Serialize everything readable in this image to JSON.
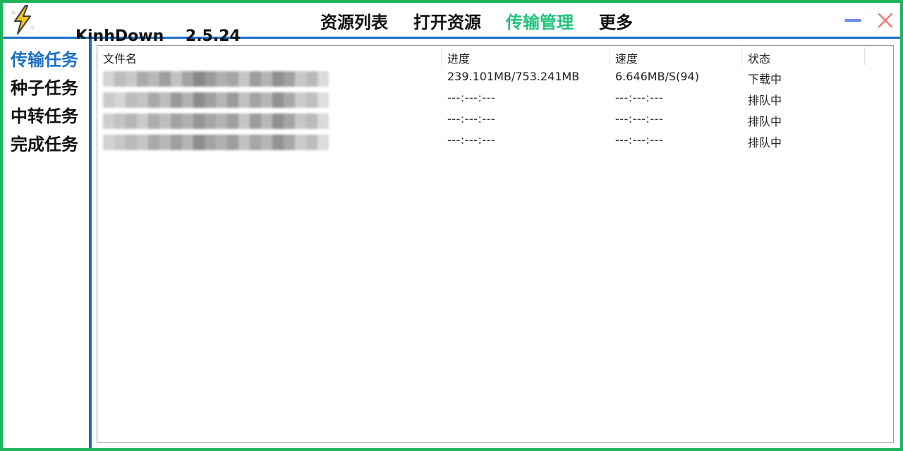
{
  "app": {
    "name": "KinhDown",
    "version": "2.5.24",
    "accent_active_nav": "#22c47a",
    "accent_blue": "#1a6fc4",
    "frame_green": "#1fb35c"
  },
  "nav": [
    {
      "label": "资源列表",
      "active": false
    },
    {
      "label": "打开资源",
      "active": false
    },
    {
      "label": "传输管理",
      "active": true
    },
    {
      "label": "更多",
      "active": false
    }
  ],
  "window_controls": {
    "minimize_icon": "minimize-icon",
    "close_icon": "close-icon"
  },
  "sidebar": [
    {
      "label": "传输任务",
      "active": true
    },
    {
      "label": "种子任务",
      "active": false
    },
    {
      "label": "中转任务",
      "active": false
    },
    {
      "label": "完成任务",
      "active": false
    }
  ],
  "table": {
    "headers": [
      "文件名",
      "进度",
      "速度",
      "状态"
    ],
    "rows": [
      {
        "name": "",
        "progress": "239.101MB/753.241MB",
        "speed": "6.646MB/S(94)",
        "status": "下载中"
      },
      {
        "name": "",
        "progress": "---:---:---",
        "speed": "---:---:---",
        "status": "排队中"
      },
      {
        "name": "",
        "progress": "---:---:---",
        "speed": "---:---:---",
        "status": "排队中"
      },
      {
        "name": "",
        "progress": "---:---:---",
        "speed": "---:---:---",
        "status": "排队中"
      }
    ]
  }
}
